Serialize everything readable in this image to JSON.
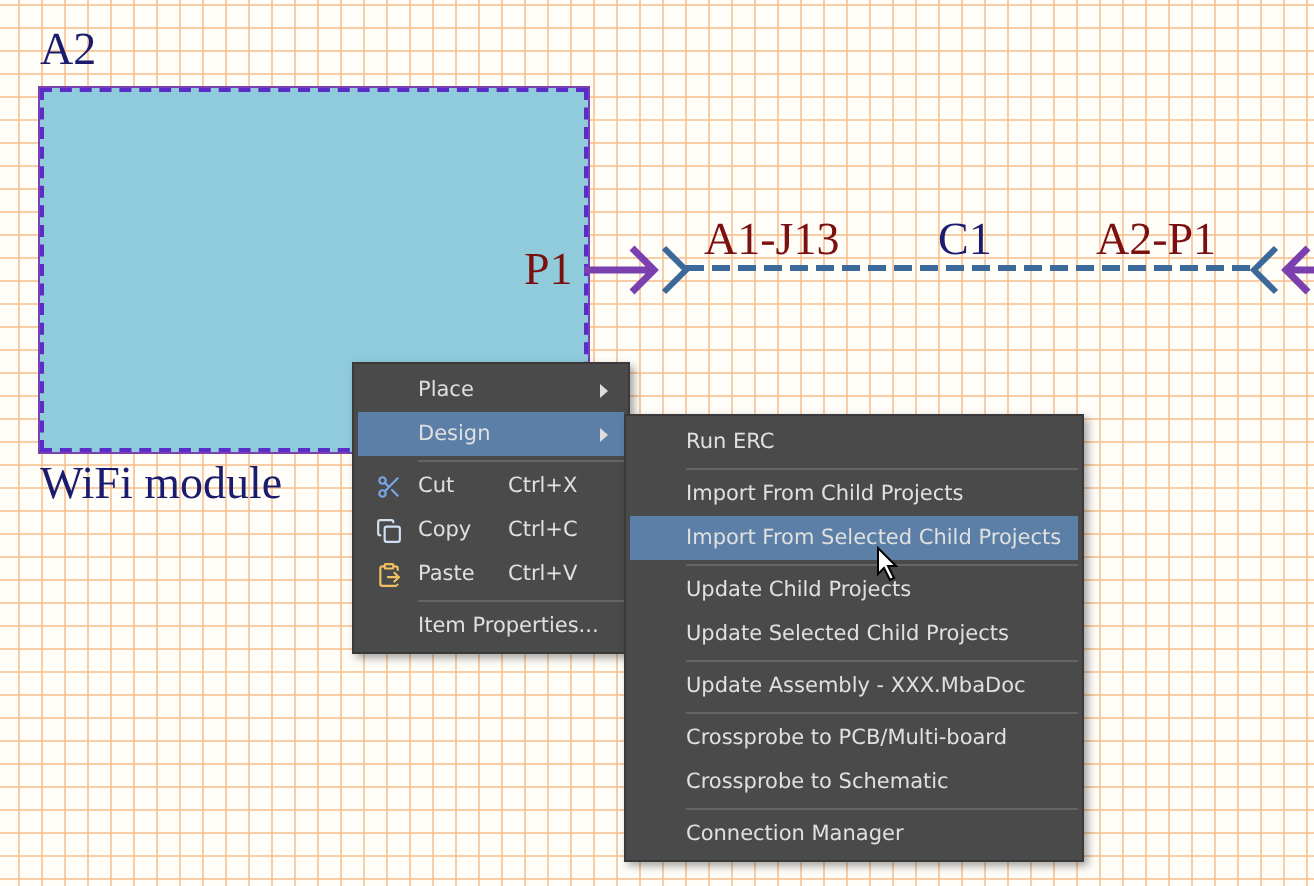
{
  "sheet_symbol": {
    "designator": "A2",
    "name": "WiFi module",
    "port": "P1"
  },
  "connection": {
    "from_label": "A1-J13",
    "cable": "C1",
    "to_label": "A2-P1"
  },
  "context_menu": {
    "items": [
      {
        "kind": "submenu",
        "label": "Place",
        "selected": false,
        "separator_before": false
      },
      {
        "kind": "submenu",
        "label": "Design",
        "selected": true,
        "separator_before": false
      },
      {
        "kind": "cut",
        "label": "Cut",
        "shortcut": "Ctrl+X",
        "selected": false,
        "separator_before": true
      },
      {
        "kind": "copy",
        "label": "Copy",
        "shortcut": "Ctrl+C",
        "selected": false,
        "separator_before": false
      },
      {
        "kind": "paste",
        "label": "Paste",
        "shortcut": "Ctrl+V",
        "selected": false,
        "separator_before": false
      },
      {
        "kind": "command",
        "label": "Item Properties...",
        "selected": false,
        "separator_before": true
      }
    ]
  },
  "submenu": {
    "items": [
      {
        "label": "Run ERC",
        "selected": false,
        "separator_before": false
      },
      {
        "label": "Import From Child Projects",
        "selected": false,
        "separator_before": true
      },
      {
        "label": "Import From Selected Child Projects",
        "selected": true,
        "separator_before": false
      },
      {
        "label": "Update Child Projects",
        "selected": false,
        "separator_before": true
      },
      {
        "label": "Update Selected Child Projects",
        "selected": false,
        "separator_before": false
      },
      {
        "label": "Update Assembly - XXX.MbaDoc",
        "selected": false,
        "separator_before": true
      },
      {
        "label": "Crossprobe to PCB/Multi-board",
        "selected": false,
        "separator_before": true
      },
      {
        "label": "Crossprobe to Schematic",
        "selected": false,
        "separator_before": false
      },
      {
        "label": "Connection Manager",
        "selected": false,
        "separator_before": true
      }
    ]
  }
}
